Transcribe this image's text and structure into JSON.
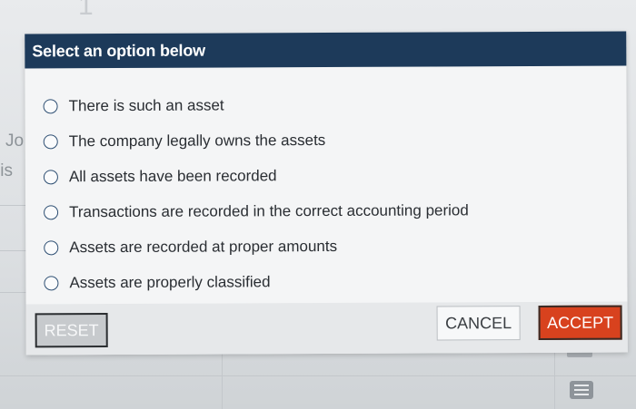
{
  "background": {
    "number": "1",
    "text_1": "Jo",
    "text_2": "lis"
  },
  "modal": {
    "title": "Select an option below",
    "options": [
      {
        "label": "There is such an asset",
        "selected": false
      },
      {
        "label": "The company legally owns the assets",
        "selected": false
      },
      {
        "label": "All assets have been recorded",
        "selected": false
      },
      {
        "label": "Transactions are recorded in the correct accounting period",
        "selected": false
      },
      {
        "label": "Assets are recorded at proper amounts",
        "selected": false
      },
      {
        "label": "Assets are properly classified",
        "selected": false
      }
    ],
    "buttons": {
      "reset": "RESET",
      "cancel": "CANCEL",
      "accept": "ACCEPT"
    }
  },
  "colors": {
    "header": "#1d3a5a",
    "accept": "#d8421e",
    "radio_border": "#2e4f73"
  },
  "icons": [
    "radio-unselected-icon",
    "list-icon"
  ]
}
